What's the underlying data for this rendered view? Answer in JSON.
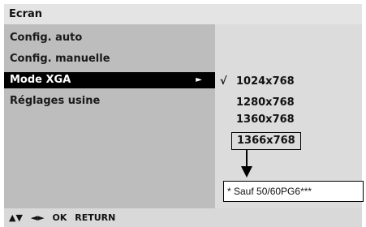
{
  "title": "Ecran",
  "menu": {
    "items": [
      {
        "label": "Config. auto"
      },
      {
        "label": "Config. manuelle"
      },
      {
        "label": "Mode XGA",
        "arrow": "►"
      },
      {
        "label": "Réglages usine"
      }
    ],
    "selected_index": 2
  },
  "options": {
    "check_mark": "√",
    "items": [
      {
        "label": "1024x768",
        "checked": true
      },
      {
        "label": "1280x768",
        "checked": false
      },
      {
        "label": "1360x768",
        "checked": false
      },
      {
        "label": "1366x768",
        "checked": false
      }
    ]
  },
  "note": "* Sauf 50/60PG6***",
  "footer": {
    "updown": "▲▼",
    "leftright": "◄►",
    "ok": "OK",
    "return": "RETURN"
  }
}
